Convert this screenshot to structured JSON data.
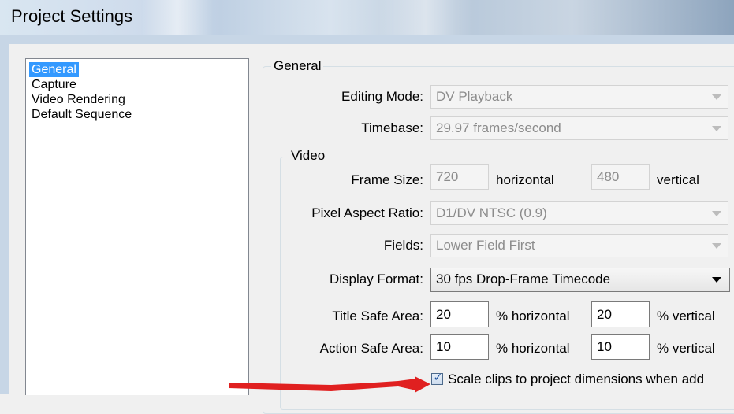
{
  "window": {
    "title": "Project Settings"
  },
  "sidebar": {
    "items": [
      {
        "label": "General",
        "selected": true
      },
      {
        "label": "Capture",
        "selected": false
      },
      {
        "label": "Video Rendering",
        "selected": false
      },
      {
        "label": "Default Sequence",
        "selected": false
      }
    ]
  },
  "general": {
    "legend": "General",
    "editing_mode": {
      "label": "Editing Mode:",
      "value": "DV Playback"
    },
    "timebase": {
      "label": "Timebase:",
      "value": "29.97 frames/second"
    }
  },
  "video": {
    "legend": "Video",
    "frame_size": {
      "label": "Frame Size:",
      "horizontal": "720",
      "horizontal_label": "horizontal",
      "vertical": "480",
      "vertical_label": "vertical"
    },
    "pixel_aspect_ratio": {
      "label": "Pixel Aspect Ratio:",
      "value": "D1/DV NTSC (0.9)"
    },
    "fields": {
      "label": "Fields:",
      "value": "Lower Field First"
    },
    "display_format": {
      "label": "Display Format:",
      "value": "30 fps Drop-Frame Timecode"
    },
    "title_safe": {
      "label": "Title Safe Area:",
      "horizontal": "20",
      "horizontal_label": "% horizontal",
      "vertical": "20",
      "vertical_label": "% vertical"
    },
    "action_safe": {
      "label": "Action Safe Area:",
      "horizontal": "10",
      "horizontal_label": "% horizontal",
      "vertical": "10",
      "vertical_label": "% vertical"
    },
    "scale_clips": {
      "label": "Scale clips to project dimensions when add",
      "checked": true
    }
  },
  "colors": {
    "selection": "#3399ff",
    "annotation_arrow": "#e02020"
  }
}
